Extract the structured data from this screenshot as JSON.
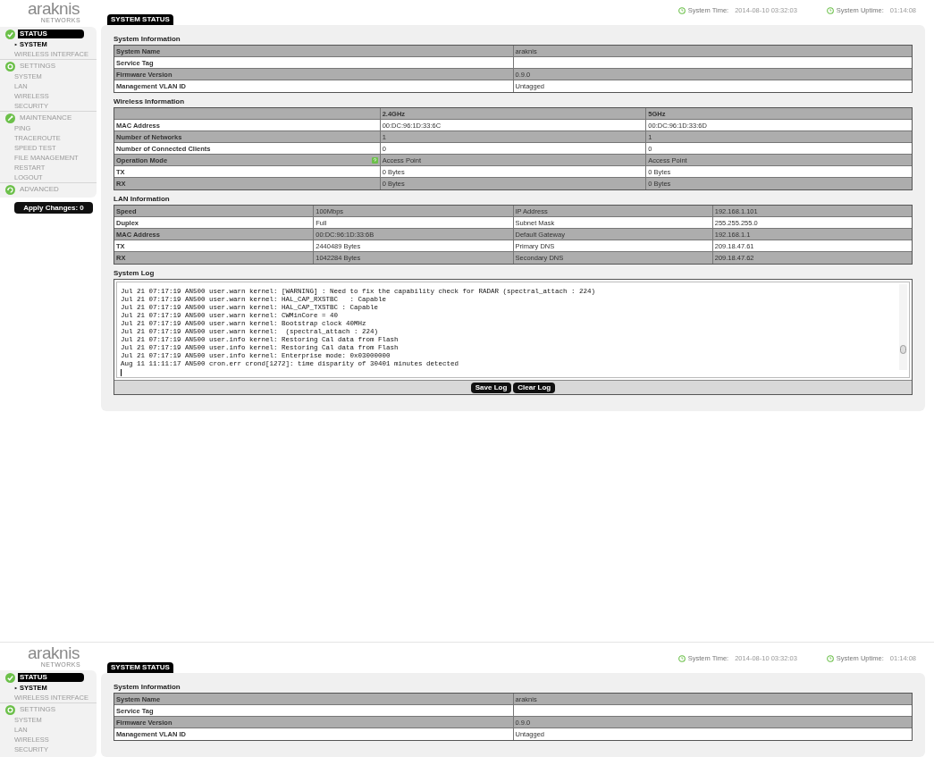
{
  "views": [
    {
      "logo": {
        "name": "araknis",
        "tagline": "NETWORKS"
      },
      "page_title": "SYSTEM STATUS",
      "system_time": {
        "label": "System Time:",
        "value": "2014-08-10 03:32:03"
      },
      "system_uptime": {
        "label": "System Uptime:",
        "value": "01:14:08"
      },
      "sidebar": [
        {
          "label": "STATUS",
          "selected": true,
          "children": [
            {
              "label": "SYSTEM",
              "selected": true
            },
            {
              "label": "WIRELESS INTERFACE",
              "selected": false
            }
          ]
        },
        {
          "label": "SETTINGS",
          "selected": false,
          "children": [
            {
              "label": "SYSTEM",
              "selected": false
            },
            {
              "label": "LAN",
              "selected": false
            },
            {
              "label": "WIRELESS",
              "selected": false
            },
            {
              "label": "SECURITY",
              "selected": false
            }
          ]
        },
        {
          "label": "MAINTENANCE",
          "selected": false,
          "children": [
            {
              "label": "PING",
              "selected": false
            },
            {
              "label": "TRACEROUTE",
              "selected": false
            },
            {
              "label": "SPEED TEST",
              "selected": false
            },
            {
              "label": "FILE MANAGEMENT",
              "selected": false
            },
            {
              "label": "RESTART",
              "selected": false
            },
            {
              "label": "LOGOUT",
              "selected": false
            }
          ]
        },
        {
          "label": "ADVANCED",
          "selected": false
        }
      ],
      "apply_button": "Apply Changes: 0",
      "sections": [
        {
          "kind": "table",
          "title": "System Information",
          "rows": [
            {
              "cells": [
                "System Name",
                "araknis"
              ]
            },
            {
              "cells": [
                "Service Tag"
              ]
            },
            {
              "cells": [
                "Firmware Version",
                "0.9.0"
              ]
            },
            {
              "cells": [
                "Management VLAN ID",
                "Untagged"
              ]
            }
          ]
        },
        {
          "kind": "table",
          "title": "Wireless Information",
          "header": [
            "2.4GHz",
            "5GHz"
          ],
          "rows": [
            {
              "cells": [
                "MAC Address",
                "00:DC:96:1D:33:6C",
                "00:DC:96:1D:33:6D"
              ]
            },
            {
              "cells": [
                "Number of Networks",
                "1",
                "1"
              ]
            },
            {
              "cells": [
                "Number of Connected Clients",
                "0",
                "0"
              ]
            },
            {
              "cells": [
                "Operation Mode",
                "Access Point",
                "Access Point"
              ],
              "help": true
            },
            {
              "cells": [
                "TX",
                "0 Bytes",
                "0 Bytes"
              ]
            },
            {
              "cells": [
                "RX",
                "0 Bytes",
                "0 Bytes"
              ]
            }
          ]
        },
        {
          "kind": "table",
          "title": "LAN Information",
          "rows": [
            {
              "cells": [
                "Speed",
                "100Mbps",
                "IP Address",
                "192.168.1.101"
              ]
            },
            {
              "cells": [
                "Duplex",
                "Full",
                "Subnet Mask",
                "255.255.255.0"
              ]
            },
            {
              "cells": [
                "MAC Address",
                "00:DC:96:1D:33:6B",
                "Default Gateway",
                "192.168.1.1"
              ]
            },
            {
              "cells": [
                "TX",
                "2440489 Bytes",
                "Primary DNS",
                "209.18.47.61"
              ]
            },
            {
              "cells": [
                "RX",
                "1042284 Bytes",
                "Secondary DNS",
                "209.18.47.62"
              ]
            }
          ]
        },
        {
          "kind": "log",
          "title": "System Log",
          "lines": [
            "Jul 21 07:17:19 AN500 user.warn kernel: [WARNING] : Need to fix the capability check for RADAR (spectral_attach : 224)",
            "Jul 21 07:17:19 AN500 user.warn kernel: HAL_CAP_RXSTBC   : Capable",
            "Jul 21 07:17:19 AN500 user.warn kernel: HAL_CAP_TXSTBC : Capable",
            "Jul 21 07:17:19 AN500 user.warn kernel: CWMinCore = 40",
            "Jul 21 07:17:19 AN500 user.warn kernel: Bootstrap clock 40MHz",
            "Jul 21 07:17:19 AN500 user.warn kernel:  (spectral_attach : 224)",
            "Jul 21 07:17:19 AN500 user.info kernel: Restoring Cal data from Flash",
            "Jul 21 07:17:19 AN500 user.info kernel: Restoring Cal data from Flash",
            "Jul 21 07:17:19 AN500 user.info kernel: Enterprise mode: 0x03000000",
            "Aug 11 11:11:17 AN500 cron.err crond[1272]: time disparity of 30401 minutes detected"
          ],
          "buttons": [
            "Save Log",
            "Clear Log"
          ]
        }
      ]
    },
    {
      "logo": {
        "name": "araknis",
        "tagline": "NETWORKS"
      },
      "page_title": "SYSTEM STATUS",
      "system_time": {
        "label": "System Time:",
        "value": "2014-08-10 03:32:03"
      },
      "system_uptime": {
        "label": "System Uptime:",
        "value": "01:14:08"
      },
      "sidebar": [
        {
          "label": "STATUS",
          "selected": true,
          "children": [
            {
              "label": "SYSTEM",
              "selected": true
            },
            {
              "label": "WIRELESS INTERFACE",
              "selected": false
            }
          ]
        },
        {
          "label": "SETTINGS",
          "selected": false,
          "children": [
            {
              "label": "SYSTEM",
              "selected": false
            },
            {
              "label": "LAN",
              "selected": false
            },
            {
              "label": "WIRELESS",
              "selected": false
            },
            {
              "label": "SECURITY",
              "selected": false
            }
          ]
        }
      ],
      "sections": [
        {
          "kind": "table",
          "title": "System Information",
          "rows": [
            {
              "cells": [
                "System Name",
                "araknis"
              ]
            },
            {
              "cells": [
                "Service Tag"
              ]
            },
            {
              "cells": [
                "Firmware Version",
                "0.9.0"
              ]
            },
            {
              "cells": [
                "Management VLAN ID",
                "Untagged"
              ]
            }
          ]
        }
      ]
    }
  ]
}
